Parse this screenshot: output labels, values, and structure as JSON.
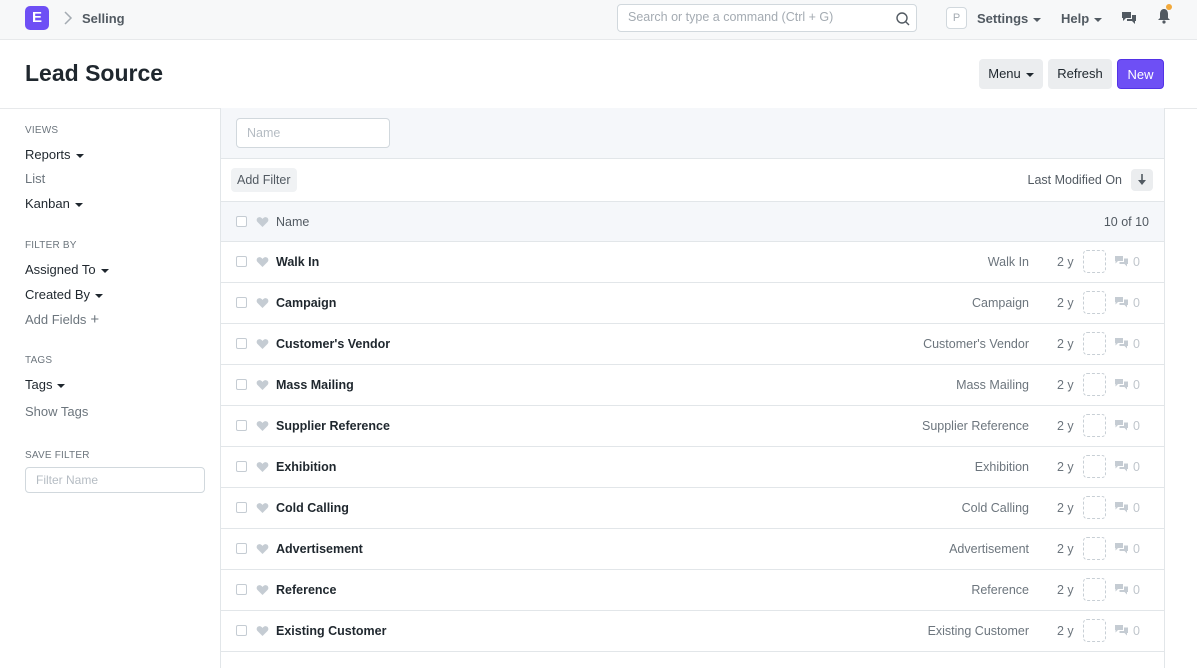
{
  "navbar": {
    "logo_letter": "E",
    "breadcrumb": "Selling",
    "search_placeholder": "Search or type a command (Ctrl + G)",
    "avatar_letter": "P",
    "settings_label": "Settings",
    "help_label": "Help"
  },
  "page": {
    "title": "Lead Source",
    "menu_label": "Menu",
    "refresh_label": "Refresh",
    "new_label": "New"
  },
  "sidebar": {
    "views_heading": "VIEWS",
    "reports_label": "Reports",
    "list_label": "List",
    "kanban_label": "Kanban",
    "filter_heading": "FILTER BY",
    "assigned_label": "Assigned To",
    "created_label": "Created By",
    "add_fields_label": "Add Fields",
    "tags_heading": "TAGS",
    "tags_label": "Tags",
    "show_tags_label": "Show Tags",
    "save_filter_heading": "SAVE FILTER",
    "filter_name_placeholder": "Filter Name"
  },
  "list": {
    "name_filter_placeholder": "Name",
    "add_filter_label": "Add Filter",
    "sort_label": "Last Modified On",
    "header_name": "Name",
    "count": "10 of 10",
    "rows": [
      {
        "title": "Walk In",
        "value": "Walk In",
        "time": "2 y",
        "comments": "0"
      },
      {
        "title": "Campaign",
        "value": "Campaign",
        "time": "2 y",
        "comments": "0"
      },
      {
        "title": "Customer's Vendor",
        "value": "Customer's Vendor",
        "time": "2 y",
        "comments": "0"
      },
      {
        "title": "Mass Mailing",
        "value": "Mass Mailing",
        "time": "2 y",
        "comments": "0"
      },
      {
        "title": "Supplier Reference",
        "value": "Supplier Reference",
        "time": "2 y",
        "comments": "0"
      },
      {
        "title": "Exhibition",
        "value": "Exhibition",
        "time": "2 y",
        "comments": "0"
      },
      {
        "title": "Cold Calling",
        "value": "Cold Calling",
        "time": "2 y",
        "comments": "0"
      },
      {
        "title": "Advertisement",
        "value": "Advertisement",
        "time": "2 y",
        "comments": "0"
      },
      {
        "title": "Reference",
        "value": "Reference",
        "time": "2 y",
        "comments": "0"
      },
      {
        "title": "Existing Customer",
        "value": "Existing Customer",
        "time": "2 y",
        "comments": "0"
      }
    ]
  },
  "colors": {
    "brand": "#6e4ff5",
    "notification_dot": "#f2a93b"
  },
  "icons": [
    "chevron-right-icon",
    "search-icon",
    "chat-icon",
    "bell-icon",
    "heart-icon",
    "comment-icon",
    "sort-arrow-icon"
  ]
}
